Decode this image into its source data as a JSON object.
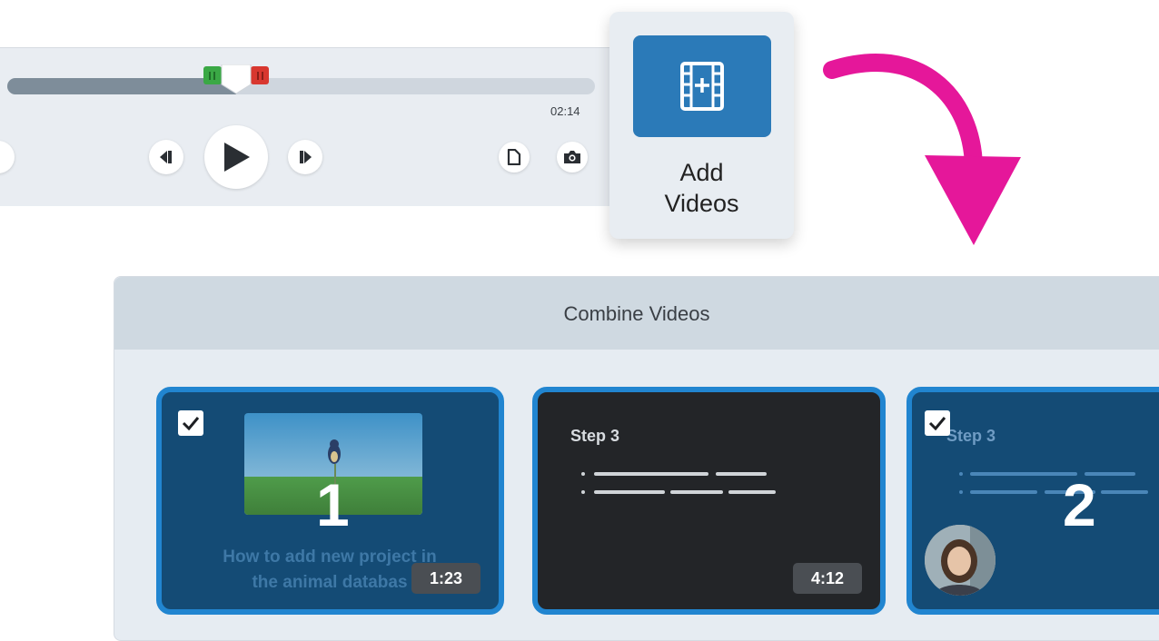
{
  "player": {
    "progress": 0.39,
    "time": "02:14",
    "icons": {
      "step_back": "step-back-icon",
      "play": "play-icon",
      "step_forward": "step-forward-icon",
      "clip": "clip-icon",
      "snapshot": "camera-icon"
    }
  },
  "add_videos": {
    "label_line1": "Add",
    "label_line2": "Videos",
    "icon": "film-plus-icon",
    "color": "#2b7ab8"
  },
  "accent": "#e5179a",
  "dialog": {
    "title": "Combine Videos",
    "cards": [
      {
        "checked": true,
        "order": "1",
        "caption_line1": "How to add new project in",
        "caption_line2": "the animal databas",
        "duration": "1:23"
      },
      {
        "checked": false,
        "step_title": "Step 3",
        "duration": "4:12"
      },
      {
        "checked": true,
        "order": "2",
        "step_title": "Step 3"
      }
    ]
  }
}
